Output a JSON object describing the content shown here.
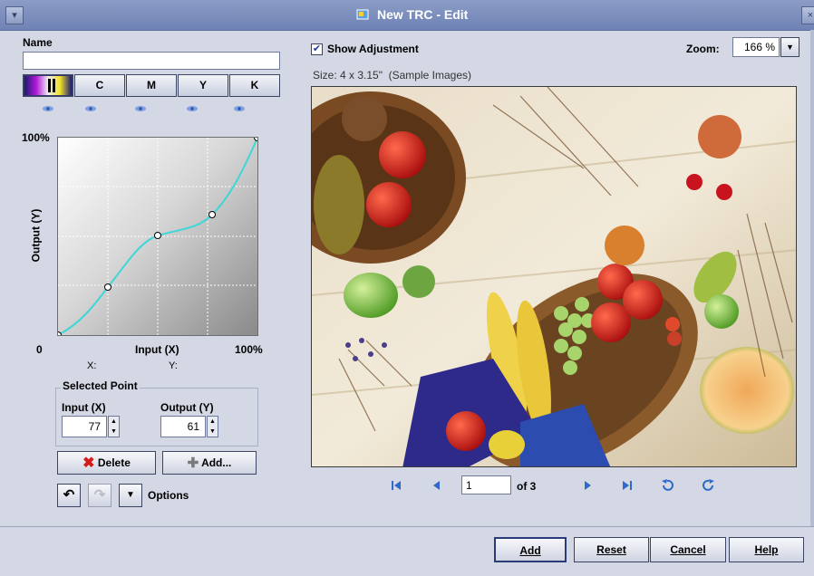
{
  "window": {
    "title": "New TRC - Edit"
  },
  "name_section": {
    "label": "Name",
    "value": ""
  },
  "channels": [
    {
      "label": ""
    },
    {
      "label": "C"
    },
    {
      "label": "M"
    },
    {
      "label": "Y"
    },
    {
      "label": "K"
    }
  ],
  "graph": {
    "y_top_label": "100%",
    "y_axis_label": "Output (Y)",
    "x_origin_label": "0",
    "x_axis_label": "Input (X)",
    "x_end_label": "100%",
    "x_readout": "X:",
    "y_readout": "Y:",
    "curve_color": "#3fd6d8"
  },
  "selected_point": {
    "title": "Selected Point",
    "input_label": "Input (X)",
    "input_value": "77",
    "output_label": "Output (Y)",
    "output_value": "61"
  },
  "buttons": {
    "delete": "Delete",
    "add_point": "Add...",
    "options": "Options",
    "add": "Add",
    "reset": "Reset",
    "cancel": "Cancel",
    "help": "Help"
  },
  "preview": {
    "show_adjustment_label": "Show Adjustment",
    "show_adjustment_checked": true,
    "zoom_label": "Zoom:",
    "zoom_value": "166 %",
    "size_text": "Size: 4 x 3.15\"  (Sample Images)"
  },
  "pager": {
    "page_value": "1",
    "of_text": "of 3"
  },
  "icons": [
    "first-page-icon",
    "prev-page-icon",
    "next-page-icon",
    "last-page-icon",
    "rotate-left-icon",
    "rotate-right-icon",
    "undo-icon",
    "redo-icon",
    "dropdown-icon",
    "eye-icon"
  ]
}
